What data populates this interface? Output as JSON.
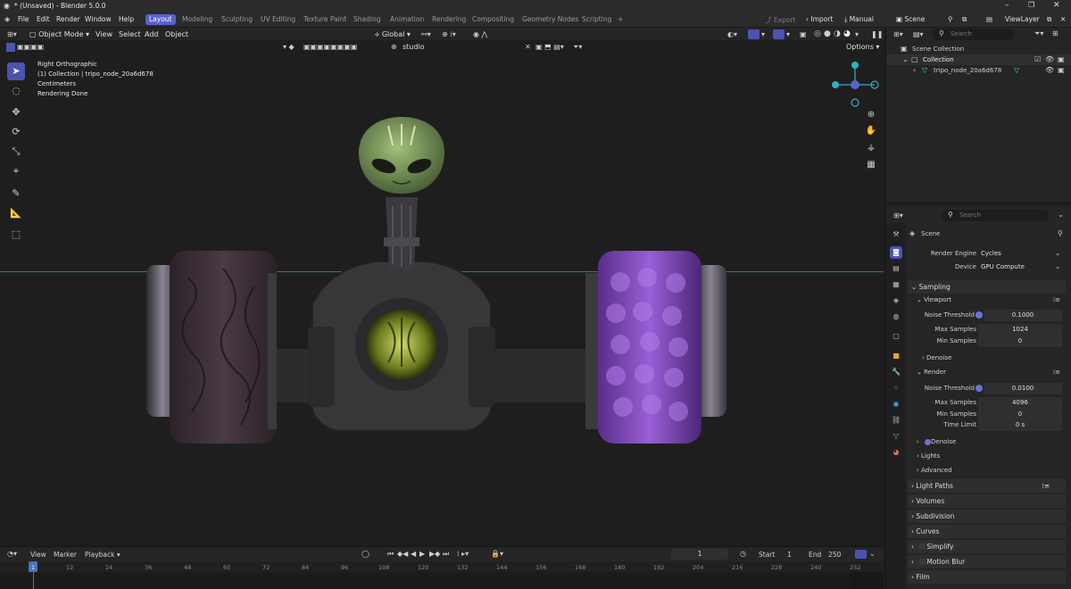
{
  "window_title": "* (Unsaved) - Blender 5.0.0",
  "menu": [
    "File",
    "Edit",
    "Render",
    "Window",
    "Help"
  ],
  "workspaces": [
    "Layout",
    "Modeling",
    "Sculpting",
    "UV Editing",
    "Texture Paint",
    "Shading",
    "Animation",
    "Rendering",
    "Compositing",
    "Geometry Nodes",
    "Scripting"
  ],
  "workspace_add": "+",
  "topright": {
    "export": "Export",
    "import": "Import",
    "manual": "Manual",
    "scene": "Scene",
    "view_layer": "ViewLayer"
  },
  "viewport_header": {
    "mode": "Object Mode",
    "view": "View",
    "select": "Select",
    "add": "Add",
    "object": "Object",
    "orientation": "Global",
    "shading_name": "studio",
    "options": "Options"
  },
  "overlay": {
    "line1": "Right Orthographic",
    "line2": "(1) Collection | tripo_node_20a6d678",
    "line3": "Centimeters",
    "line4": "Rendering Done"
  },
  "outliner": {
    "search_placeholder": "Search",
    "root": "Scene Collection",
    "collection": "Collection",
    "object": "tripo_node_20a6d678"
  },
  "properties": {
    "search_placeholder": "Search",
    "context": "Scene",
    "render_engine_label": "Render Engine",
    "render_engine": "Cycles",
    "device_label": "Device",
    "device": "GPU Compute",
    "sampling": "Sampling",
    "viewport": "Viewport",
    "noise_threshold_label": "Noise Threshold",
    "vp_noise_threshold": "0.1000",
    "max_samples_label": "Max Samples",
    "vp_max_samples": "1024",
    "min_samples_label": "Min Samples",
    "vp_min_samples": "0",
    "denoise": "Denoise",
    "render": "Render",
    "r_noise_threshold": "0.0100",
    "r_max_samples": "4096",
    "r_min_samples": "0",
    "time_limit_label": "Time Limit",
    "r_time_limit": "0 s",
    "denoise2": "Denoise",
    "lights": "Lights",
    "advanced": "Advanced",
    "panels": [
      "Light Paths",
      "Volumes",
      "Subdivision",
      "Curves",
      "Simplify",
      "Motion Blur",
      "Film"
    ]
  },
  "timeline": {
    "view": "View",
    "marker": "Marker",
    "playback": "Playback",
    "current_frame": "1",
    "start_label": "Start",
    "start": "1",
    "end_label": "End",
    "end": "250",
    "ticks": [
      "1",
      "12",
      "24",
      "36",
      "48",
      "60",
      "72",
      "84",
      "96",
      "108",
      "120",
      "132",
      "144",
      "156",
      "168",
      "180",
      "192",
      "204",
      "216",
      "228",
      "240",
      "252"
    ]
  },
  "colors": {
    "accent": "#5a62c8",
    "bg": "#1e1e1e",
    "panel": "#252525",
    "dot": "#6d72d8"
  }
}
